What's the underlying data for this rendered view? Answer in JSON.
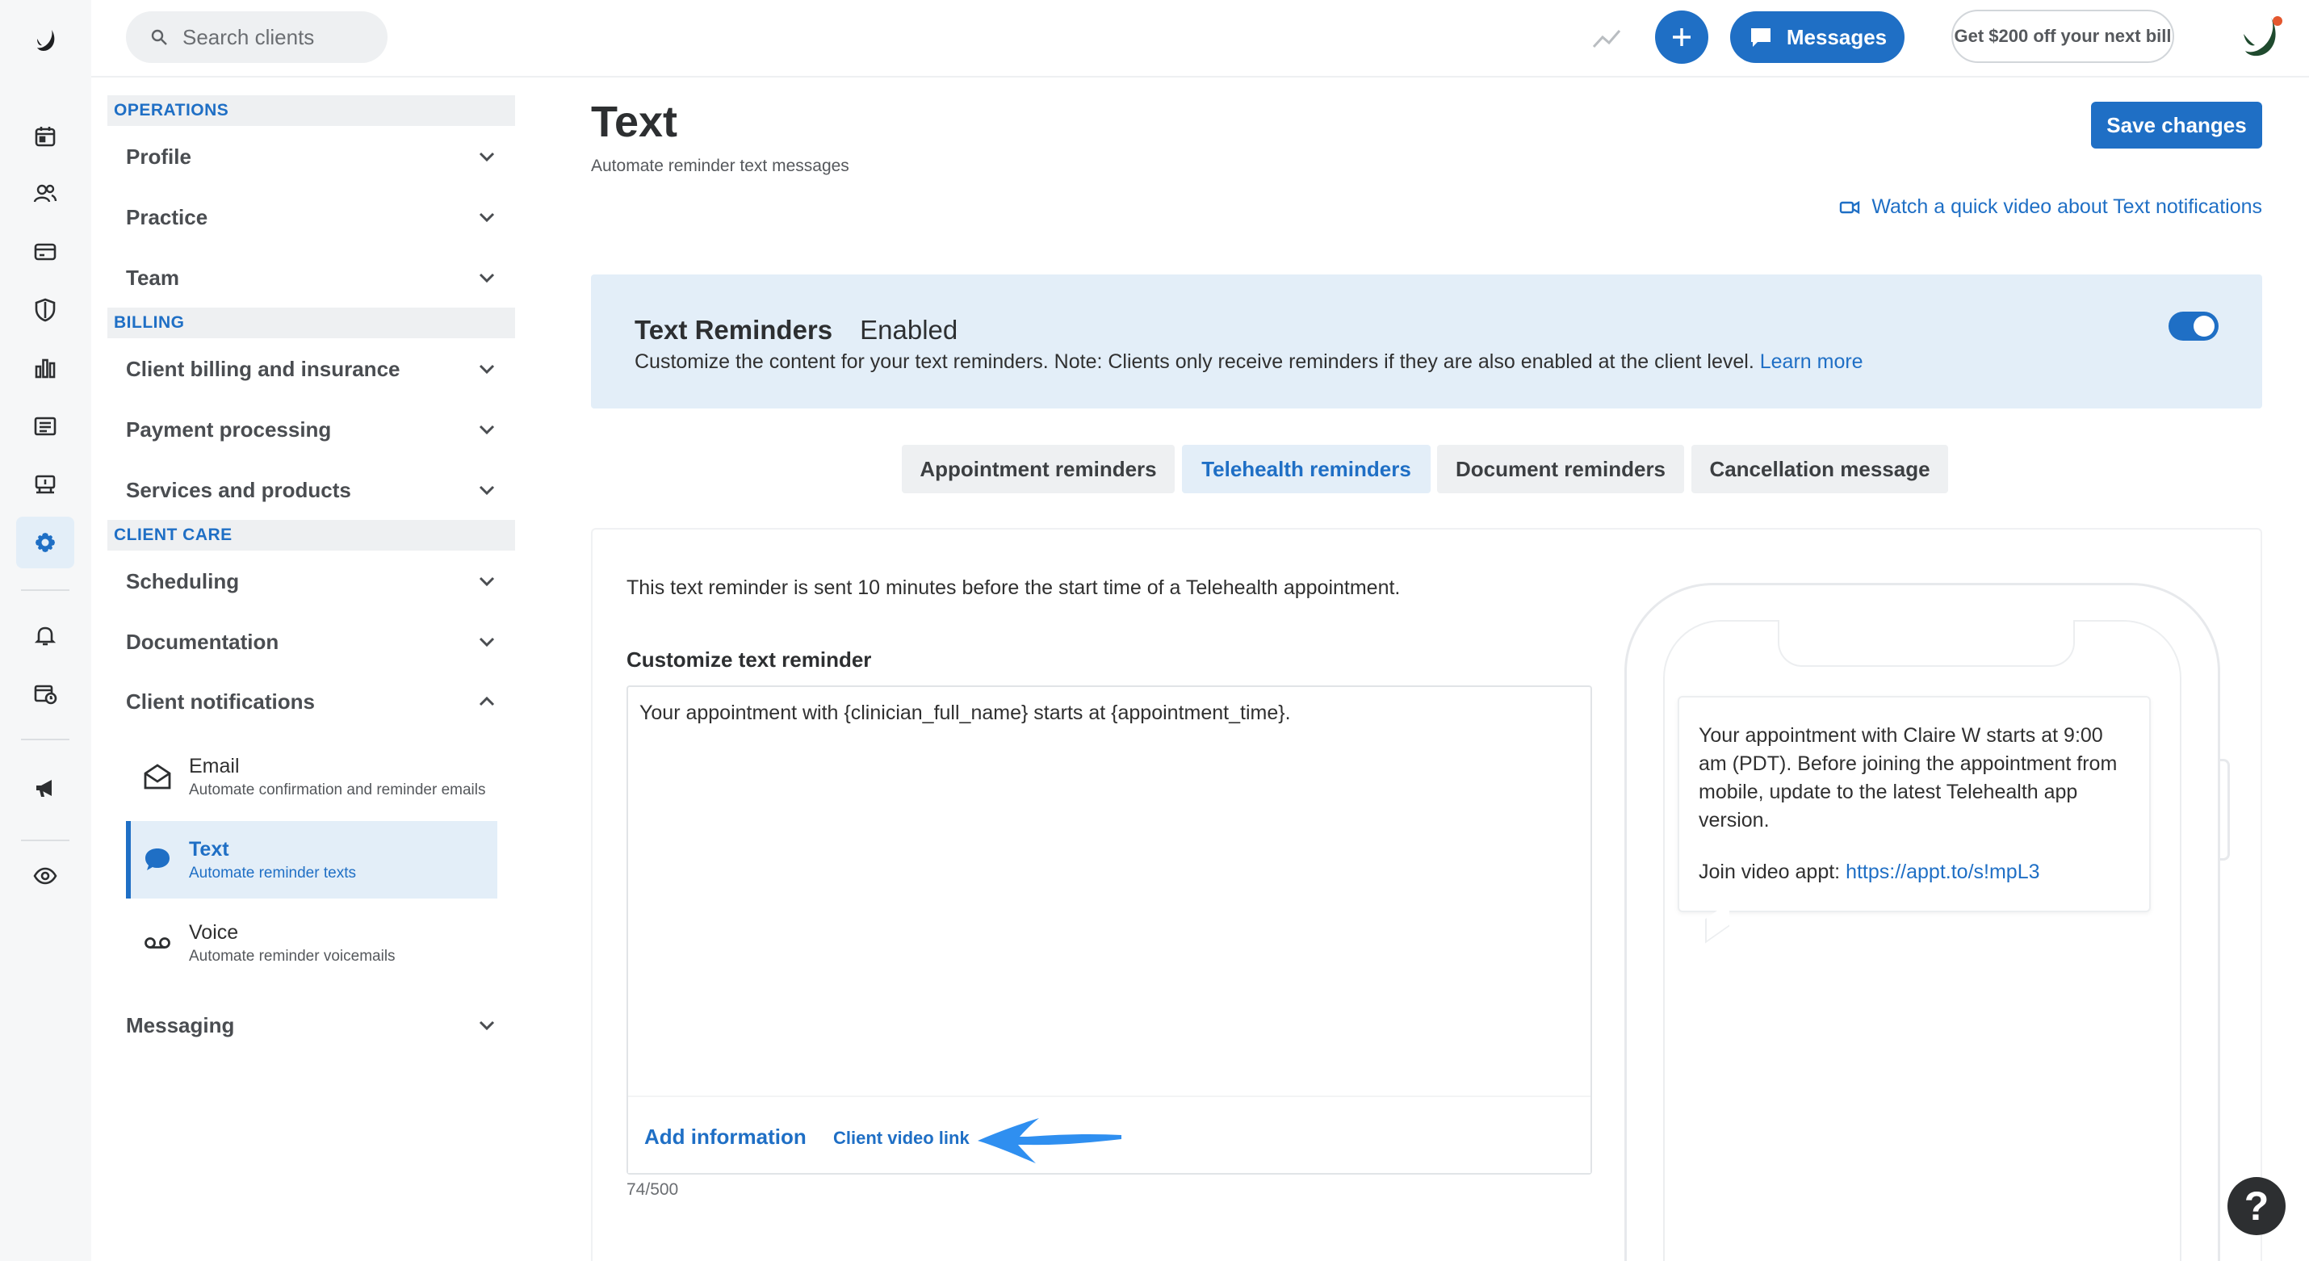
{
  "app": {
    "logo_name": "simplepractice-logo"
  },
  "topbar": {
    "search_placeholder": "Search clients",
    "messages_label": "Messages",
    "promo_label": "Get $200 off your next bill"
  },
  "rail": {
    "icons": [
      "calendar-icon",
      "clients-icon",
      "billing-icon",
      "insurance-shield-icon",
      "analytics-icon",
      "documents-icon",
      "marketplace-icon",
      "settings-icon",
      "notifications-bell-icon",
      "reminders-icon",
      "announcements-megaphone-icon",
      "visibility-eye-icon"
    ],
    "active": "settings-icon"
  },
  "menu": {
    "operations_header": "OPERATIONS",
    "profile": "Profile",
    "practice": "Practice",
    "team": "Team",
    "billing_header": "BILLING",
    "client_billing": "Client billing and insurance",
    "payment_processing": "Payment processing",
    "services_products": "Services and products",
    "client_care_header": "CLIENT CARE",
    "scheduling": "Scheduling",
    "documentation": "Documentation",
    "client_notifications": "Client notifications",
    "email_title": "Email",
    "email_desc": "Automate confirmation and reminder emails",
    "text_title": "Text",
    "text_desc": "Automate reminder texts",
    "voice_title": "Voice",
    "voice_desc": "Automate reminder voicemails",
    "messaging": "Messaging"
  },
  "main": {
    "title": "Text",
    "subtitle": "Automate reminder text messages",
    "save_label": "Save changes",
    "video_link": "Watch a quick video about Text notifications",
    "banner": {
      "title": "Text Reminders",
      "status": "Enabled",
      "description": "Customize the content for your text reminders. Note: Clients only receive reminders if they are also enabled at the client level.",
      "learn_more": "Learn more",
      "enabled": true
    },
    "tabs": [
      "Appointment reminders",
      "Telehealth reminders",
      "Document reminders",
      "Cancellation message"
    ],
    "active_tab": "Telehealth reminders",
    "panel_description": "This text reminder is sent 10 minutes before the start time of a Telehealth appointment.",
    "customize_label": "Customize text reminder",
    "editor_value": "Your appointment with {clinician_full_name} starts at {appointment_time}.",
    "add_information": "Add information",
    "client_video_link": "Client video link",
    "char_counter": "74/500",
    "preview": {
      "message": "Your appointment with Claire W starts at 9:00 am (PDT). Before joining the appointment from mobile, update to the latest Telehealth app version.",
      "join_label": "Join video appt:",
      "join_url": "https://appt.to/s!mpL3"
    }
  },
  "help_label": "?",
  "colors": {
    "accent": "#1f6fc5",
    "banner_bg": "#e3eef8",
    "arrow": "#2f8ff0"
  }
}
